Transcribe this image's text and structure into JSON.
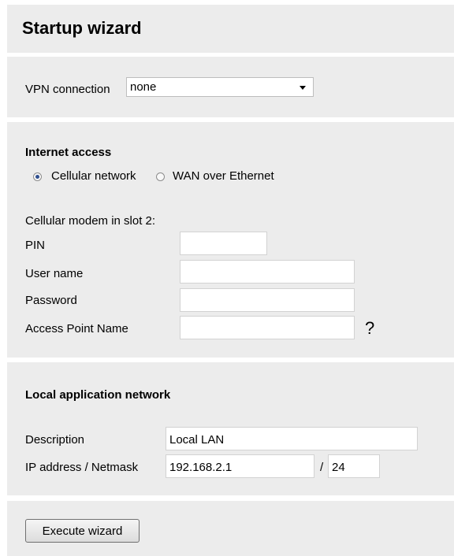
{
  "title": "Startup wizard",
  "vpn": {
    "label": "VPN connection",
    "selected": "none"
  },
  "internet": {
    "heading": "Internet access",
    "options": [
      {
        "label": "Cellular network",
        "checked": true
      },
      {
        "label": "WAN over Ethernet",
        "checked": false
      }
    ],
    "modem_label": "Cellular modem in slot 2:",
    "pin_label": "PIN",
    "pin_value": "",
    "username_label": "User name",
    "username_value": "",
    "password_label": "Password",
    "password_value": "",
    "apn_label": "Access Point Name",
    "apn_value": "",
    "help_icon": "?"
  },
  "local": {
    "heading": "Local application network",
    "description_label": "Description",
    "description_value": "Local LAN",
    "ip_label": "IP address / Netmask",
    "ip_value": "192.168.2.1",
    "separator": "/",
    "netmask_value": "24"
  },
  "execute_label": "Execute wizard"
}
